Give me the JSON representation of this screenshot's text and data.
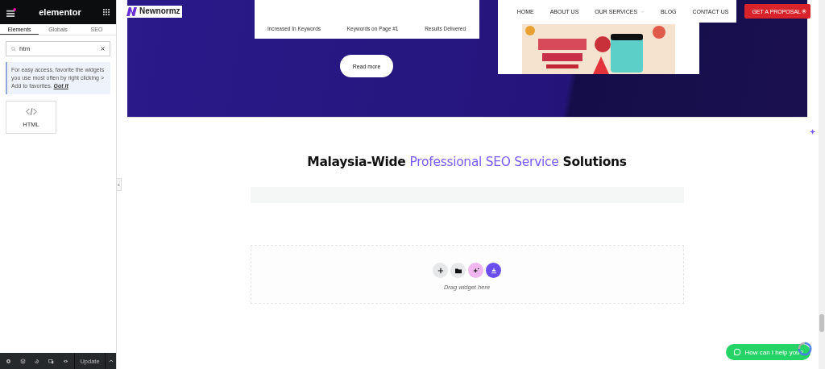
{
  "editor": {
    "brand": "elementor",
    "tabs": [
      {
        "label": "Elements",
        "selected": true
      },
      {
        "label": "Globals",
        "selected": false
      },
      {
        "label": "SEO",
        "selected": false
      }
    ],
    "search": {
      "value": "htm"
    },
    "tip": {
      "text": "For easy access, favorite the widgets you use most often by right clicking > Add to favorites.",
      "link": "Got It"
    },
    "widgets": [
      {
        "label": "HTML"
      }
    ],
    "footer": {
      "button": "Update"
    }
  },
  "site": {
    "logo": "Newnormz",
    "nav": [
      {
        "label": "HOME",
        "dropdown": false
      },
      {
        "label": "ABOUT US",
        "dropdown": false
      },
      {
        "label": "OUR SERVICES",
        "dropdown": true
      },
      {
        "label": "BLOG",
        "dropdown": false
      },
      {
        "label": "CONTACT US",
        "dropdown": false
      }
    ],
    "cta": "GET A PROPOSAL",
    "stats": [
      {
        "label": "Increased In Keywords"
      },
      {
        "label": "Keywords on Page #1"
      },
      {
        "label": "Results Delivered"
      }
    ],
    "read_more": "Read more",
    "heading": {
      "before": "Malaysia-Wide ",
      "highlight": "Professional SEO Service",
      "after": " Solutions"
    },
    "drop_zone": {
      "hint": "Drag widget here"
    },
    "chat": "How can I help you?"
  }
}
